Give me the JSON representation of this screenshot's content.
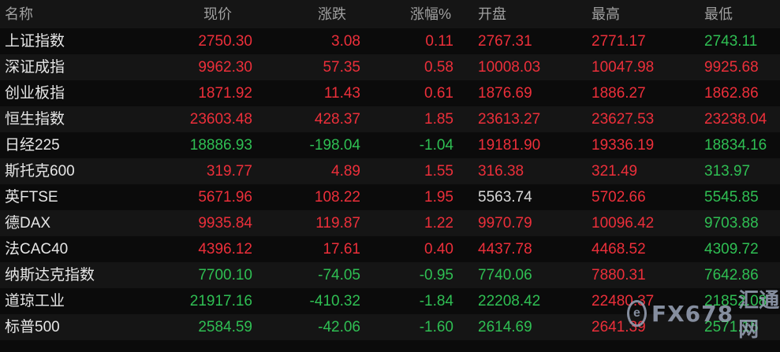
{
  "headers": {
    "name": "名称",
    "price": "现价",
    "change": "涨跌",
    "pct": "涨幅%",
    "open": "开盘",
    "high": "最高",
    "low": "最低"
  },
  "rows": [
    {
      "name": "上证指数",
      "price": "2750.30",
      "change": "3.08",
      "pct": "0.11",
      "open": "2767.31",
      "high": "2771.17",
      "low": "2743.11",
      "colors": {
        "price": "#ec2f3a",
        "change": "#ec2f3a",
        "pct": "#ec2f3a",
        "open": "#ec2f3a",
        "high": "#ec2f3a",
        "low": "#2fbf53"
      }
    },
    {
      "name": "深证成指",
      "price": "9962.30",
      "change": "57.35",
      "pct": "0.58",
      "open": "10008.03",
      "high": "10047.98",
      "low": "9925.68",
      "colors": {
        "price": "#ec2f3a",
        "change": "#ec2f3a",
        "pct": "#ec2f3a",
        "open": "#ec2f3a",
        "high": "#ec2f3a",
        "low": "#ec2f3a"
      }
    },
    {
      "name": "创业板指",
      "price": "1871.92",
      "change": "11.43",
      "pct": "0.61",
      "open": "1876.69",
      "high": "1886.27",
      "low": "1862.86",
      "colors": {
        "price": "#ec2f3a",
        "change": "#ec2f3a",
        "pct": "#ec2f3a",
        "open": "#ec2f3a",
        "high": "#ec2f3a",
        "low": "#ec2f3a"
      }
    },
    {
      "name": "恒生指数",
      "price": "23603.48",
      "change": "428.37",
      "pct": "1.85",
      "open": "23613.27",
      "high": "23627.53",
      "low": "23238.04",
      "colors": {
        "price": "#ec2f3a",
        "change": "#ec2f3a",
        "pct": "#ec2f3a",
        "open": "#ec2f3a",
        "high": "#ec2f3a",
        "low": "#ec2f3a"
      }
    },
    {
      "name": "日经225",
      "price": "18886.93",
      "change": "-198.04",
      "pct": "-1.04",
      "open": "19181.90",
      "high": "19336.19",
      "low": "18834.16",
      "colors": {
        "price": "#2fbf53",
        "change": "#2fbf53",
        "pct": "#2fbf53",
        "open": "#ec2f3a",
        "high": "#ec2f3a",
        "low": "#2fbf53"
      }
    },
    {
      "name": "斯托克600",
      "price": "319.77",
      "change": "4.89",
      "pct": "1.55",
      "open": "316.38",
      "high": "321.49",
      "low": "313.97",
      "colors": {
        "price": "#ec2f3a",
        "change": "#ec2f3a",
        "pct": "#ec2f3a",
        "open": "#ec2f3a",
        "high": "#ec2f3a",
        "low": "#2fbf53"
      }
    },
    {
      "name": "英FTSE",
      "price": "5671.96",
      "change": "108.22",
      "pct": "1.95",
      "open": "5563.74",
      "high": "5702.66",
      "low": "5545.85",
      "colors": {
        "price": "#ec2f3a",
        "change": "#ec2f3a",
        "pct": "#ec2f3a",
        "open": "#d8d8d8",
        "high": "#ec2f3a",
        "low": "#2fbf53"
      }
    },
    {
      "name": "德DAX",
      "price": "9935.84",
      "change": "119.87",
      "pct": "1.22",
      "open": "9970.79",
      "high": "10096.42",
      "low": "9703.88",
      "colors": {
        "price": "#ec2f3a",
        "change": "#ec2f3a",
        "pct": "#ec2f3a",
        "open": "#ec2f3a",
        "high": "#ec2f3a",
        "low": "#2fbf53"
      }
    },
    {
      "name": "法CAC40",
      "price": "4396.12",
      "change": "17.61",
      "pct": "0.40",
      "open": "4437.78",
      "high": "4468.52",
      "low": "4309.72",
      "colors": {
        "price": "#ec2f3a",
        "change": "#ec2f3a",
        "pct": "#ec2f3a",
        "open": "#ec2f3a",
        "high": "#ec2f3a",
        "low": "#2fbf53"
      }
    },
    {
      "name": "纳斯达克指数",
      "price": "7700.10",
      "change": "-74.05",
      "pct": "-0.95",
      "open": "7740.06",
      "high": "7880.31",
      "low": "7642.86",
      "colors": {
        "price": "#2fbf53",
        "change": "#2fbf53",
        "pct": "#2fbf53",
        "open": "#2fbf53",
        "high": "#ec2f3a",
        "low": "#2fbf53"
      }
    },
    {
      "name": "道琼工业",
      "price": "21917.16",
      "change": "-410.32",
      "pct": "-1.84",
      "open": "22208.42",
      "high": "22480.37",
      "low": "21852.08",
      "colors": {
        "price": "#2fbf53",
        "change": "#2fbf53",
        "pct": "#2fbf53",
        "open": "#2fbf53",
        "high": "#ec2f3a",
        "low": "#2fbf53"
      }
    },
    {
      "name": "标普500",
      "price": "2584.59",
      "change": "-42.06",
      "pct": "-1.60",
      "open": "2614.69",
      "high": "2641.39",
      "low": "2571.15",
      "colors": {
        "price": "#2fbf53",
        "change": "#2fbf53",
        "pct": "#2fbf53",
        "open": "#2fbf53",
        "high": "#ec2f3a",
        "low": "#2fbf53"
      }
    }
  ],
  "watermark": {
    "logo_letter": "e",
    "text": "FX678",
    "cn": "汇通网"
  }
}
